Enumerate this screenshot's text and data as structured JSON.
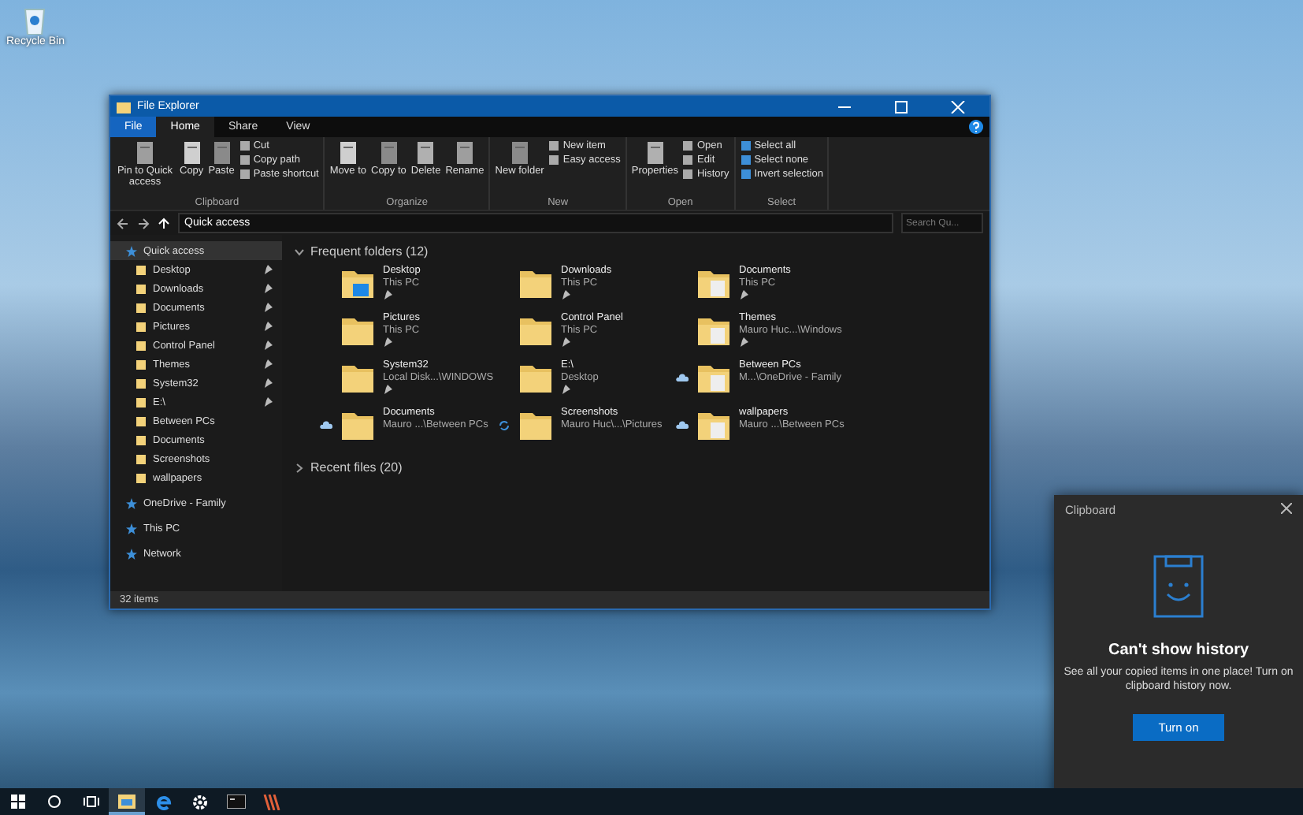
{
  "desktop_icons": [
    {
      "label": "Recycle Bin"
    }
  ],
  "explorer": {
    "title": "File Explorer",
    "ribbon_tabs": [
      {
        "label": "File",
        "kind": "file",
        "selected": false
      },
      {
        "label": "Home",
        "kind": "tab",
        "selected": true
      },
      {
        "label": "Share",
        "kind": "tab",
        "selected": false
      },
      {
        "label": "View",
        "kind": "tab",
        "selected": false
      }
    ],
    "ribbon_groups": [
      {
        "label": "Clipboard",
        "buttons": [
          {
            "label": "Pin to Quick access",
            "kind": "large"
          },
          {
            "label": "Copy",
            "kind": "large"
          },
          {
            "label": "Paste",
            "kind": "large"
          },
          {
            "label": "Cut",
            "kind": "small"
          },
          {
            "label": "Copy path",
            "kind": "small"
          },
          {
            "label": "Paste shortcut",
            "kind": "small"
          }
        ]
      },
      {
        "label": "Organize",
        "buttons": [
          {
            "label": "Move to",
            "kind": "large"
          },
          {
            "label": "Copy to",
            "kind": "large"
          },
          {
            "label": "Delete",
            "kind": "large"
          },
          {
            "label": "Rename",
            "kind": "large"
          }
        ]
      },
      {
        "label": "New",
        "buttons": [
          {
            "label": "New folder",
            "kind": "large"
          },
          {
            "label": "New item",
            "kind": "small"
          },
          {
            "label": "Easy access",
            "kind": "small"
          }
        ]
      },
      {
        "label": "Open",
        "buttons": [
          {
            "label": "Properties",
            "kind": "large"
          },
          {
            "label": "Open",
            "kind": "small"
          },
          {
            "label": "Edit",
            "kind": "small"
          },
          {
            "label": "History",
            "kind": "small"
          }
        ]
      },
      {
        "label": "Select",
        "buttons": [
          {
            "label": "Select all",
            "kind": "small"
          },
          {
            "label": "Select none",
            "kind": "small"
          },
          {
            "label": "Invert selection",
            "kind": "small"
          }
        ]
      }
    ],
    "address": {
      "path": "Quick access",
      "search_placeholder": "Search Qu..."
    },
    "sidebar": [
      {
        "label": "Quick access",
        "selected": true,
        "children": [
          {
            "label": "Desktop",
            "pinned": true,
            "selected": false
          },
          {
            "label": "Downloads",
            "pinned": true,
            "selected": false
          },
          {
            "label": "Documents",
            "pinned": true,
            "selected": false
          },
          {
            "label": "Pictures",
            "pinned": true,
            "selected": false
          },
          {
            "label": "Control Panel",
            "pinned": true,
            "selected": false
          },
          {
            "label": "Themes",
            "pinned": true,
            "selected": false
          },
          {
            "label": "System32",
            "pinned": true,
            "selected": false
          },
          {
            "label": "E:\\",
            "pinned": true,
            "selected": false
          },
          {
            "label": "Between PCs",
            "pinned": false,
            "selected": false
          },
          {
            "label": "Documents",
            "pinned": false,
            "selected": false
          },
          {
            "label": "Screenshots",
            "pinned": false,
            "selected": false
          },
          {
            "label": "wallpapers",
            "pinned": false,
            "selected": false
          }
        ]
      },
      {
        "label": "OneDrive - Family",
        "selected": false
      },
      {
        "label": "This PC",
        "selected": false
      },
      {
        "label": "Network",
        "selected": false
      }
    ],
    "sections": [
      {
        "title": "Frequent folders (12)",
        "expanded": true,
        "items": [
          {
            "name": "Desktop",
            "location": "This PC",
            "pinned": true
          },
          {
            "name": "Downloads",
            "location": "This PC",
            "pinned": true
          },
          {
            "name": "Documents",
            "location": "This PC",
            "pinned": true
          },
          {
            "name": "Pictures",
            "location": "This PC",
            "pinned": true
          },
          {
            "name": "Control Panel",
            "location": "This PC",
            "pinned": true
          },
          {
            "name": "Themes",
            "location": "Mauro Huc...\\Windows",
            "pinned": true
          },
          {
            "name": "System32",
            "location": "Local Disk...\\WINDOWS",
            "pinned": true
          },
          {
            "name": "E:\\",
            "location": "Desktop",
            "pinned": true
          },
          {
            "name": "Between PCs",
            "location": "M...\\OneDrive - Family",
            "pinned": false,
            "cloud": true
          },
          {
            "name": "Documents",
            "location": "Mauro ...\\Between PCs",
            "pinned": false,
            "cloud": true
          },
          {
            "name": "Screenshots",
            "location": "Mauro Huc\\...\\Pictures",
            "pinned": false,
            "syncing": true
          },
          {
            "name": "wallpapers",
            "location": "Mauro ...\\Between PCs",
            "pinned": false,
            "cloud": true
          }
        ]
      },
      {
        "title": "Recent files (20)",
        "expanded": false
      }
    ],
    "status": "32 items"
  },
  "clipboard": {
    "title": "Clipboard",
    "heading": "Can't show history",
    "message": "See all your copied items in one place! Turn on clipboard history now.",
    "button": "Turn on"
  },
  "taskbar_apps": [
    {
      "selected": true
    },
    {
      "selected": false
    },
    {
      "selected": false
    },
    {
      "selected": false
    },
    {
      "selected": false
    }
  ]
}
